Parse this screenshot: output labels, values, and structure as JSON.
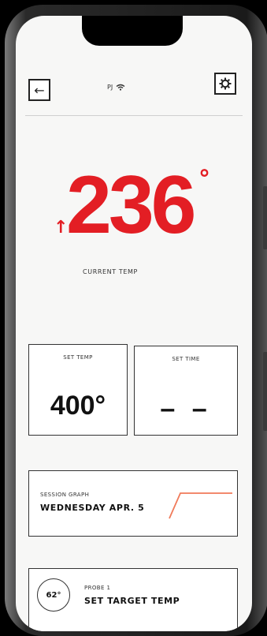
{
  "header": {
    "device_name": "PJ"
  },
  "current": {
    "temp": "236",
    "degree": "°",
    "label": "CURRENT TEMP",
    "trend_arrow": "↑"
  },
  "set_temp": {
    "label": "SET TEMP",
    "value": "400°"
  },
  "set_time": {
    "label": "SET TIME",
    "value": "– –"
  },
  "session_graph": {
    "label": "SESSION GRAPH",
    "date": "WEDNESDAY APR. 5"
  },
  "probe": {
    "label": "PROBE 1",
    "action": "SET TARGET TEMP",
    "temp": "62°"
  },
  "colors": {
    "accent": "#e31e24",
    "graph_line": "#f07a5a"
  },
  "icons": {
    "back": "arrow-left-icon",
    "settings": "gear-icon",
    "wifi": "wifi-icon"
  }
}
